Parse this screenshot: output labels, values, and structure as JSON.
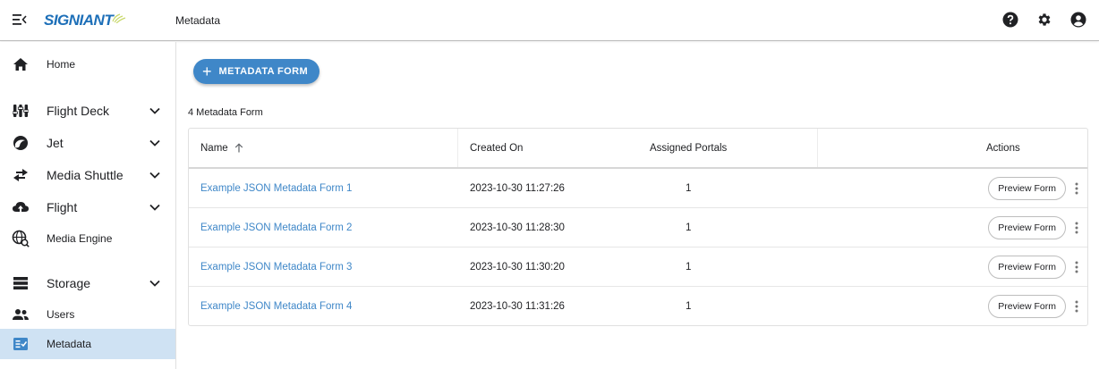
{
  "app": {
    "logo_text": "SIGNIANT",
    "page_heading": "Metadata"
  },
  "topbar": {
    "icons": [
      "help-icon",
      "gear-icon",
      "account-icon"
    ]
  },
  "sidebar": {
    "items": [
      {
        "label": "Home",
        "icon": "home-icon"
      },
      {
        "label": "Flight Deck",
        "icon": "flight-deck-icon"
      },
      {
        "label": "Jet",
        "icon": "jet-icon"
      },
      {
        "label": "Media Shuttle",
        "icon": "transfer-arrows-icon"
      },
      {
        "label": "Flight",
        "icon": "cloud-upload-icon"
      },
      {
        "label": "Media Engine",
        "icon": "globe-search-icon"
      },
      {
        "label": "Storage",
        "icon": "storage-icon"
      },
      {
        "label": "Users",
        "icon": "users-icon"
      },
      {
        "label": "Metadata",
        "icon": "metadata-icon"
      }
    ]
  },
  "main": {
    "add_button_label": "METADATA FORM",
    "count_label": "4 Metadata Form",
    "table": {
      "columns": {
        "name": "Name",
        "created_on": "Created On",
        "assigned_portals": "Assigned Portals",
        "actions": "Actions"
      },
      "preview_label": "Preview Form",
      "rows": [
        {
          "name": "Example JSON Metadata Form 1",
          "created_on": "2023-10-30 11:27:26",
          "assigned_portals": "1"
        },
        {
          "name": "Example JSON Metadata Form 2",
          "created_on": "2023-10-30 11:28:30",
          "assigned_portals": "1"
        },
        {
          "name": "Example JSON Metadata Form 3",
          "created_on": "2023-10-30 11:30:20",
          "assigned_portals": "1"
        },
        {
          "name": "Example JSON Metadata Form 4",
          "created_on": "2023-10-30 11:31:26",
          "assigned_portals": "1"
        }
      ]
    }
  },
  "colors": {
    "accent": "#3f87c8",
    "active_nav": "#cfe2f3",
    "logo": "#1d6fb8"
  }
}
